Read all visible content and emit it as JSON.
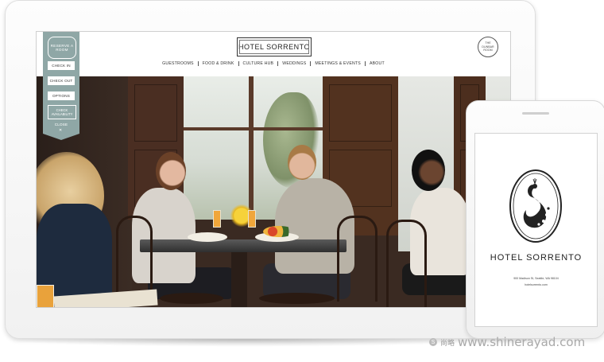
{
  "hotel": {
    "logo_text": "HOTEL SORRENTO",
    "badge_text": "THE DUNBAR ROOM"
  },
  "nav": {
    "items": [
      "GUESTROOMS",
      "FOOD & DRINK",
      "CULTURE HUB",
      "WEDDINGS",
      "MEETINGS & EVENTS",
      "ABOUT"
    ]
  },
  "reserve_panel": {
    "title": "RESERVE A ROOM",
    "buttons": [
      "CHECK IN",
      "CHECK OUT",
      "OPTIONS"
    ],
    "check_availability": "CHECK AVAILABILITY",
    "close": "CLOSE",
    "close_glyph": "✕"
  },
  "phone": {
    "title": "HOTEL SORRENTO",
    "address": "900 Madison St, Seattle, WA 98104",
    "url": "hotelsorrento.com"
  },
  "watermark": {
    "cn": "尚略",
    "url": "www.shinerayad.com"
  },
  "colors": {
    "panel": "#8fa7a6",
    "text_dark": "#222222"
  }
}
